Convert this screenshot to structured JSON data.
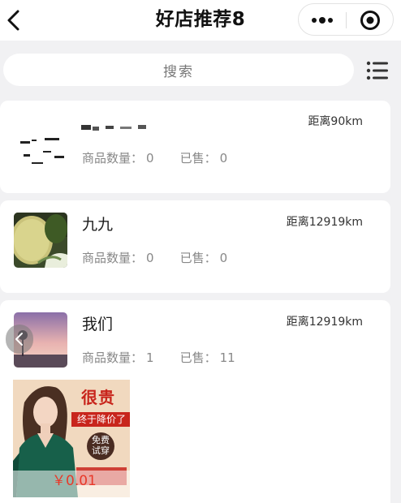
{
  "nav": {
    "title": "好店推荐8"
  },
  "search": {
    "placeholder": "搜索"
  },
  "shops": [
    {
      "name": "",
      "distance": "距离90km",
      "goods_label": "商品数量：",
      "goods_count": "0",
      "sold_label": "已售：",
      "sold_count": "0"
    },
    {
      "name": "九九",
      "distance": "距离12919km",
      "goods_label": "商品数量：",
      "goods_count": "0",
      "sold_label": "已售：",
      "sold_count": "0"
    },
    {
      "name": "我们",
      "distance": "距离12919km",
      "goods_label": "商品数量：",
      "goods_count": "1",
      "sold_label": "已售：",
      "sold_count": "11",
      "products": [
        {
          "price": "￥0.01",
          "badge_main": "很贵",
          "badge_sub": "终于降价了",
          "badge_circle": "免费试穿"
        }
      ]
    }
  ],
  "colors": {
    "background": "#f1f1f3",
    "price": "#e8392a",
    "badge_red": "#c8251c"
  }
}
